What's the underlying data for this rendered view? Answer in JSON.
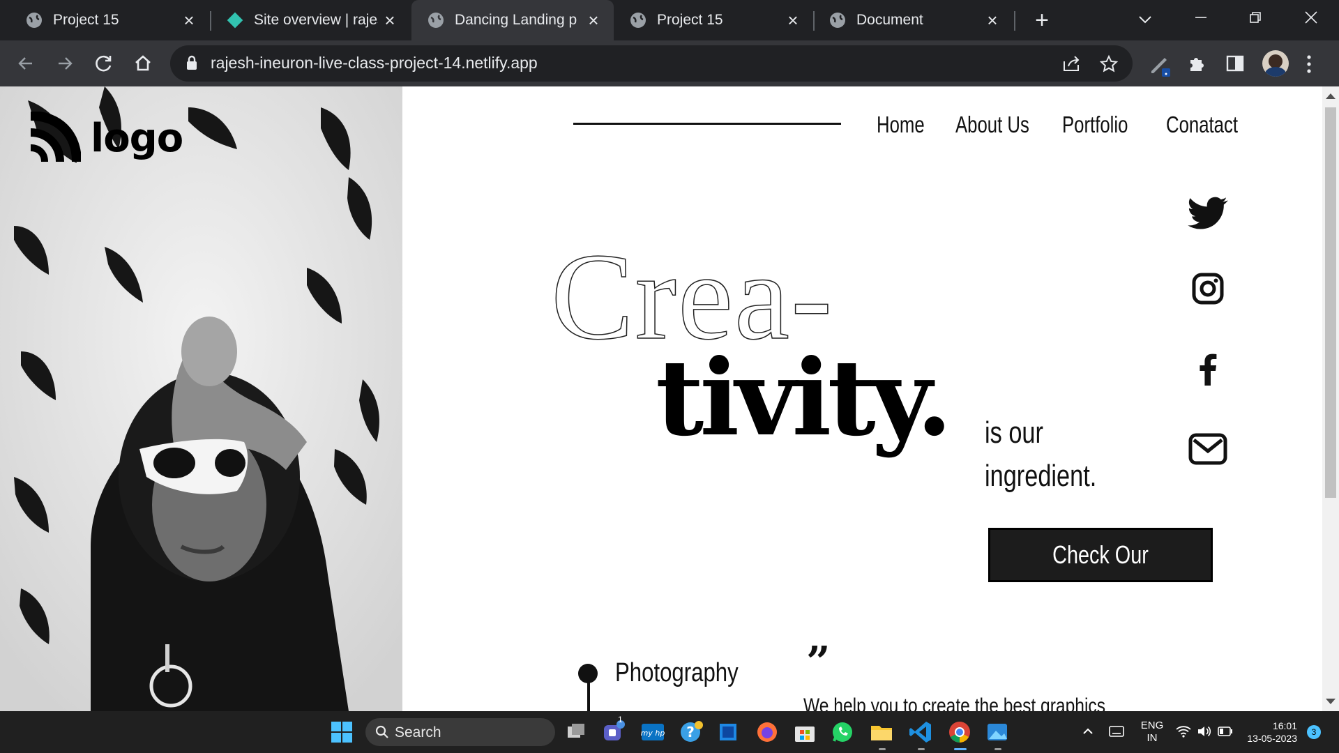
{
  "browser": {
    "tabs": [
      {
        "title": "Project 15",
        "active": false
      },
      {
        "title": "Site overview | rajesh",
        "active": false
      },
      {
        "title": "Dancing Landing page",
        "active": true
      },
      {
        "title": "Project 15",
        "active": false
      },
      {
        "title": "Document",
        "active": false
      }
    ],
    "url": "rajesh-ineuron-live-class-project-14.netlify.app"
  },
  "site": {
    "logo": "logo",
    "nav": [
      "Home",
      "About Us",
      "Portfolio",
      "Conatact"
    ],
    "headline_outline": "Crea-",
    "headline_bold": "tivity.",
    "tagline_line1": "is our",
    "tagline_line2": "ingredient.",
    "cta": "Check Our Package",
    "service": "Photography",
    "quote_mark": "”",
    "testimonial": "We help you to create the best graphics",
    "social": [
      "twitter-icon",
      "instagram-icon",
      "facebook-icon",
      "mail-icon"
    ]
  },
  "taskbar": {
    "search": "Search",
    "lang1": "ENG",
    "lang2": "IN",
    "time": "16:01",
    "date": "13-05-2023",
    "notifications": "3",
    "chat_badge": "1"
  },
  "colors": {
    "chrome_dark": "#202124",
    "chrome_toolbar": "#35363a",
    "page_bg": "#ffffff",
    "ink": "#111111",
    "cta_bg": "#1c1c1c",
    "taskbar": "#202020"
  }
}
